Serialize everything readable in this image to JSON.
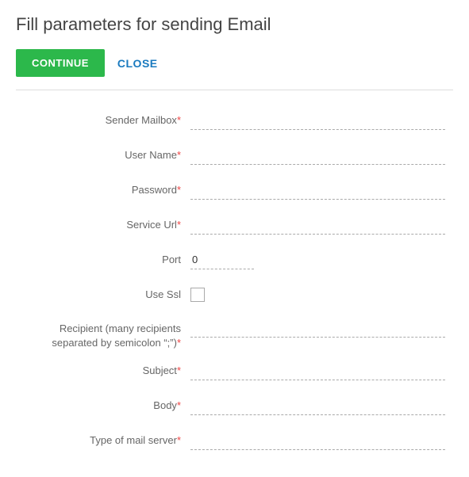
{
  "page": {
    "title": "Fill parameters for sending Email"
  },
  "toolbar": {
    "continue_label": "CONTINUE",
    "close_label": "CLOSE"
  },
  "form": {
    "fields": [
      {
        "id": "sender-mailbox",
        "label": "Sender Mailbox",
        "required": true,
        "type": "text",
        "value": ""
      },
      {
        "id": "user-name",
        "label": "User Name",
        "required": true,
        "type": "text",
        "value": ""
      },
      {
        "id": "password",
        "label": "Password",
        "required": true,
        "type": "password",
        "value": ""
      },
      {
        "id": "service-url",
        "label": "Service Url",
        "required": true,
        "type": "text",
        "value": ""
      }
    ],
    "port": {
      "label": "Port",
      "value": "0"
    },
    "ssl": {
      "label": "Use Ssl",
      "checked": false
    },
    "recipient": {
      "label": "Recipient (many recipients separated by semicolon \";\") ",
      "required": true,
      "value": ""
    },
    "subject": {
      "label": "Subject",
      "required": true,
      "value": ""
    },
    "body": {
      "label": "Body",
      "required": true,
      "value": ""
    },
    "mail_server_type": {
      "label": "Type of mail server",
      "required": true,
      "value": ""
    },
    "required_star": "*"
  }
}
